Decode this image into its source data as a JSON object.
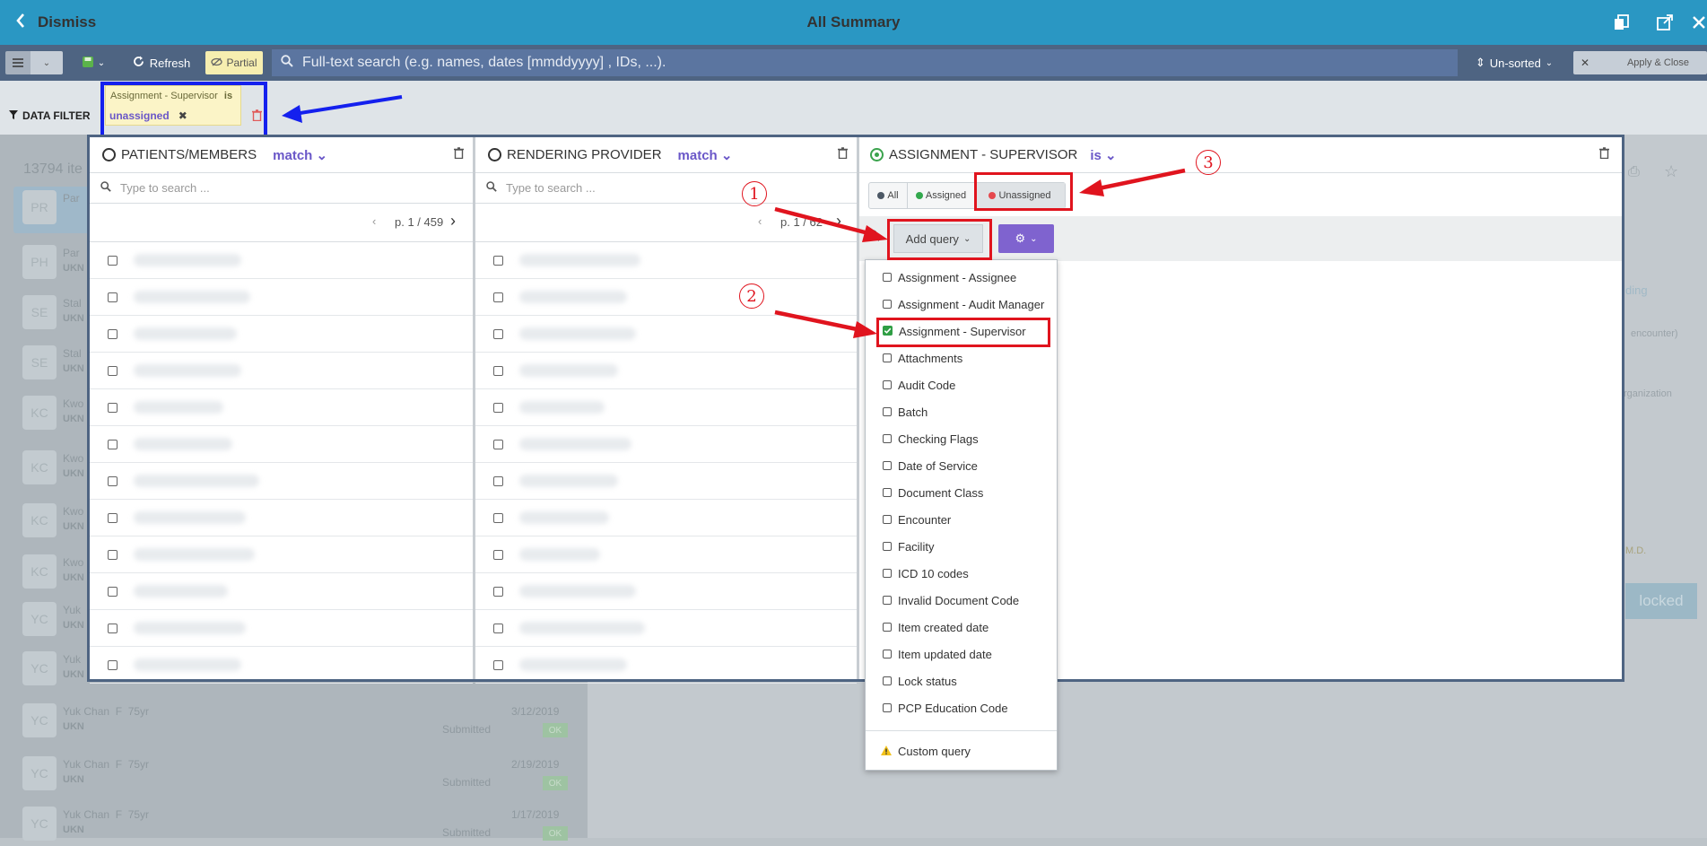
{
  "header": {
    "dismiss_label": "Dismiss",
    "title": "All Summary",
    "icons": [
      "copy-icon",
      "external-link-icon",
      "close-icon"
    ]
  },
  "toolbar": {
    "refresh_label": "Refresh",
    "partial_label": "Partial",
    "search_placeholder": "Full-text search (e.g. names, dates [mmddyyyy] , IDs, ...).",
    "sort_label": "Un-sorted",
    "apply_close_label": "Apply & Close"
  },
  "filter_bar": {
    "label": "DATA FILTER",
    "chip": {
      "field": "Assignment - Supervisor",
      "operator": "is",
      "value": "unassigned"
    }
  },
  "background_list": {
    "count_text": "13794 ite",
    "rows": [
      {
        "initials": "PR",
        "name": "Par",
        "sub": ""
      },
      {
        "initials": "PH",
        "name": "Par",
        "sub": "UKN"
      },
      {
        "initials": "SE",
        "name": "Stal",
        "sub": "UKN"
      },
      {
        "initials": "SE",
        "name": "Stal",
        "sub": "UKN"
      },
      {
        "initials": "KC",
        "name": "Kwo",
        "sub": "UKN"
      },
      {
        "initials": "KC",
        "name": "Kwo",
        "sub": "UKN"
      },
      {
        "initials": "KC",
        "name": "Kwo",
        "sub": "UKN"
      },
      {
        "initials": "KC",
        "name": "Kwo",
        "sub": "UKN"
      },
      {
        "initials": "YC",
        "name": "Yuk",
        "sub": "UKN"
      },
      {
        "initials": "YC",
        "name": "Yuk",
        "sub": "UKN"
      },
      {
        "initials": "YC",
        "name": "Yuk Chan  F  75yr",
        "sub": "UKN",
        "dos": "3/12/2019",
        "status": "Submitted",
        "badge": "OK"
      },
      {
        "initials": "YC",
        "name": "Yuk Chan  F  75yr",
        "sub": "UKN",
        "dos": "2/19/2019",
        "status": "Submitted",
        "badge": "OK"
      },
      {
        "initials": "YC",
        "name": "Yuk Chan  F  75yr",
        "sub": "UKN",
        "dos": "1/17/2019",
        "status": "Submitted",
        "badge": "OK"
      }
    ],
    "right_fragments": {
      "ending": "ding",
      "encounter": "encounter)",
      "organization": "rganization",
      "md": "M.D.",
      "locked": "locked"
    }
  },
  "panels": {
    "patients": {
      "title": "PATIENTS/MEMBERS",
      "mode": "match",
      "search_placeholder": "Type to search ...",
      "page": "p. 1 / 459"
    },
    "provider": {
      "title": "RENDERING PROVIDER",
      "mode": "match",
      "search_placeholder": "Type to search ...",
      "page": "p. 1 / 62"
    },
    "supervisor": {
      "title": "ASSIGNMENT - SUPERVISOR",
      "mode": "is",
      "filters": [
        "All",
        "Assigned",
        "Unassigned"
      ],
      "add_query_label": "Add query"
    }
  },
  "dropdown": {
    "items": [
      {
        "label": "Assignment - Assignee",
        "checked": false
      },
      {
        "label": "Assignment - Audit Manager",
        "checked": false
      },
      {
        "label": "Assignment - Supervisor",
        "checked": true
      },
      {
        "label": "Attachments",
        "checked": false
      },
      {
        "label": "Audit Code",
        "checked": false
      },
      {
        "label": "Batch",
        "checked": false
      },
      {
        "label": "Checking Flags",
        "checked": false
      },
      {
        "label": "Date of Service",
        "checked": false
      },
      {
        "label": "Document Class",
        "checked": false
      },
      {
        "label": "Encounter",
        "checked": false
      },
      {
        "label": "Facility",
        "checked": false
      },
      {
        "label": "ICD 10 codes",
        "checked": false
      },
      {
        "label": "Invalid Document Code",
        "checked": false
      },
      {
        "label": "Item created date",
        "checked": false
      },
      {
        "label": "Item updated date",
        "checked": false
      },
      {
        "label": "Lock status",
        "checked": false
      },
      {
        "label": "PCP Education Code",
        "checked": false
      }
    ],
    "custom_query_label": "Custom query"
  },
  "annotations": {
    "step1": "1",
    "step2": "2",
    "step3": "3"
  },
  "colors": {
    "header": "#2a97c3",
    "toolbar": "#4e6482",
    "accent_purple": "#6a57c8",
    "annotation_red": "#e0141e",
    "annotation_blue": "#1420ee"
  }
}
